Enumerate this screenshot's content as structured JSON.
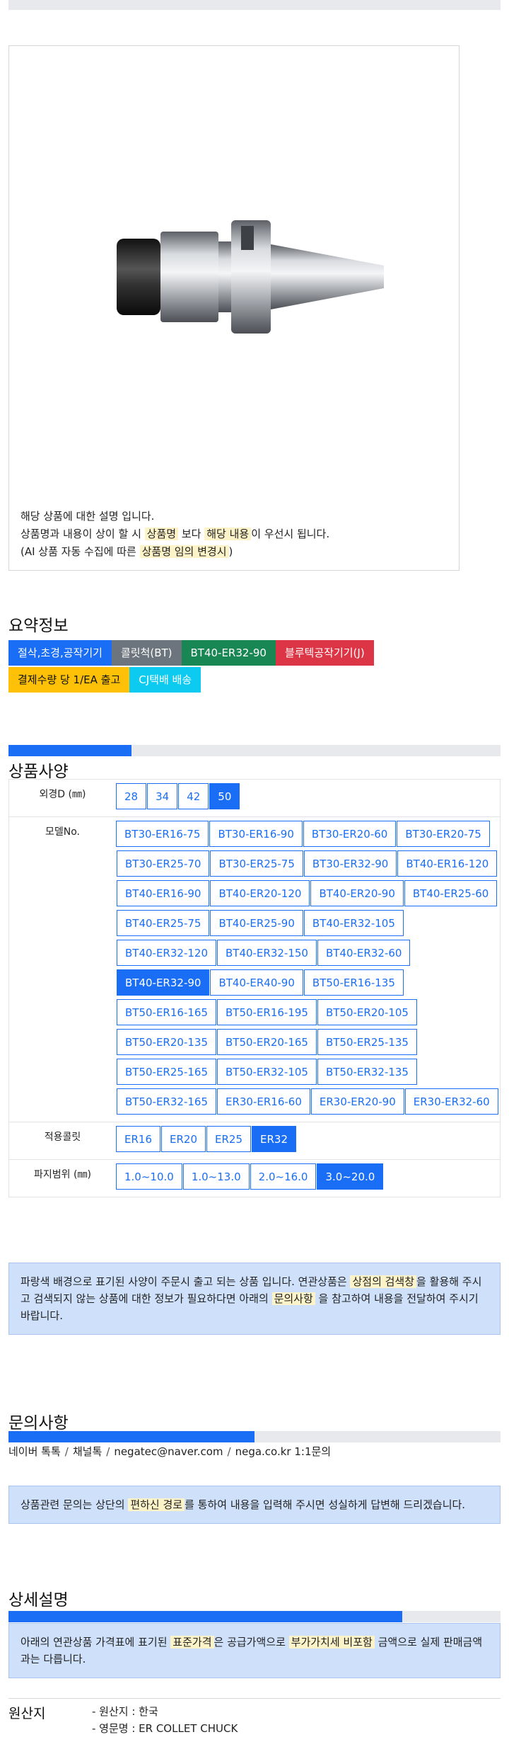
{
  "description": {
    "line1": "해당 상품에 대한 설명 입니다.",
    "line2_pre": "상품명과 내용이 상이 할 시",
    "line2_hl1": "상품명",
    "line2_mid": "보다",
    "line2_hl2": "해당 내용",
    "line2_post": "이 우선시 됩니다.",
    "line3_pre": "(AI 상품 자동 수집에 따른",
    "line3_hl": "상품명 임의 변경시",
    "line3_post": ")"
  },
  "summary": {
    "title": "요약정보",
    "tags": [
      {
        "label": "절삭,초경,공작기기",
        "color": "#1a6ef5"
      },
      {
        "label": "콜릿척(BT)",
        "color": "#6c757d"
      },
      {
        "label": "BT40-ER32-90",
        "color": "#198754"
      },
      {
        "label": "블루텍공작기기(J)",
        "color": "#dc3545"
      },
      {
        "label": "결제수량 당 1/EA 출고",
        "color": "#ffc107"
      },
      {
        "label": "CJ택배 배송",
        "color": "#0dcaf0"
      }
    ]
  },
  "spec": {
    "title": "상품사양",
    "progress": 0.25,
    "rows": [
      {
        "label": "외경D (㎜)",
        "options": [
          "28",
          "34",
          "42",
          "50"
        ],
        "selected": "50"
      },
      {
        "label": "모델No.",
        "options": [
          "BT30-ER16-75",
          "BT30-ER16-90",
          "BT30-ER20-60",
          "BT30-ER20-75",
          "BT30-ER25-70",
          "BT30-ER25-75",
          "BT30-ER32-90",
          "BT40-ER16-120",
          "BT40-ER16-90",
          "BT40-ER20-120",
          "BT40-ER20-90",
          "BT40-ER25-60",
          "BT40-ER25-75",
          "BT40-ER25-90",
          "BT40-ER32-105",
          "BT40-ER32-120",
          "BT40-ER32-150",
          "BT40-ER32-60",
          "BT40-ER32-90",
          "BT40-ER40-90",
          "BT50-ER16-135",
          "BT50-ER16-165",
          "BT50-ER16-195",
          "BT50-ER20-105",
          "BT50-ER20-135",
          "BT50-ER20-165",
          "BT50-ER25-135",
          "BT50-ER25-165",
          "BT50-ER32-105",
          "BT50-ER32-135",
          "BT50-ER32-165",
          "ER30-ER16-60",
          "ER30-ER20-90",
          "ER30-ER32-60"
        ],
        "selected": "BT40-ER32-90"
      },
      {
        "label": "적용콜릿",
        "options": [
          "ER16",
          "ER20",
          "ER25",
          "ER32"
        ],
        "selected": "ER32"
      },
      {
        "label": "파지범위 (㎜)",
        "options": [
          "1.0~10.0",
          "1.0~13.0",
          "2.0~16.0",
          "3.0~20.0"
        ],
        "selected": "3.0~20.0"
      }
    ],
    "notice": {
      "pre": "파랑색 배경으로 표기된 사양이 주문시 출고 되는 상품 입니다. 연관상품은",
      "hl1": "상점의 검색창",
      "mid": "을 활용해 주시고 검색되지 않는 상품에 대한 정보가 필요하다면 아래의",
      "hl2": "문의사항",
      "post": "을 참고하여 내용을 전달하여 주시기 바랍니다."
    }
  },
  "inquiry": {
    "title": "문의사항",
    "progress": 0.5,
    "contacts": [
      "네이버 톡톡",
      "채널톡",
      "negatec@naver.com",
      "nega.co.kr 1:1문의"
    ],
    "separator": "/",
    "notice": {
      "pre": "상품관련 문의는 상단의",
      "hl": "편하신 경로",
      "post": "를 통하여 내용을 입력해 주시면 성실하게 답변해 드리겠습니다."
    }
  },
  "detail": {
    "title": "상세설명",
    "progress": 0.8,
    "notice": {
      "pre": "아래의 연관상품 가격표에 표기된",
      "hl1": "표준가격",
      "mid": "은 공급가액으로",
      "hl2": "부가가치세 비포함",
      "post": "금액으로 실제 판매금액과는 다릅니다."
    }
  },
  "origin": {
    "label": "원산지",
    "country": "- 원산지 : 한국",
    "english_name": "- 영문명 : ER COLLET CHUCK"
  }
}
